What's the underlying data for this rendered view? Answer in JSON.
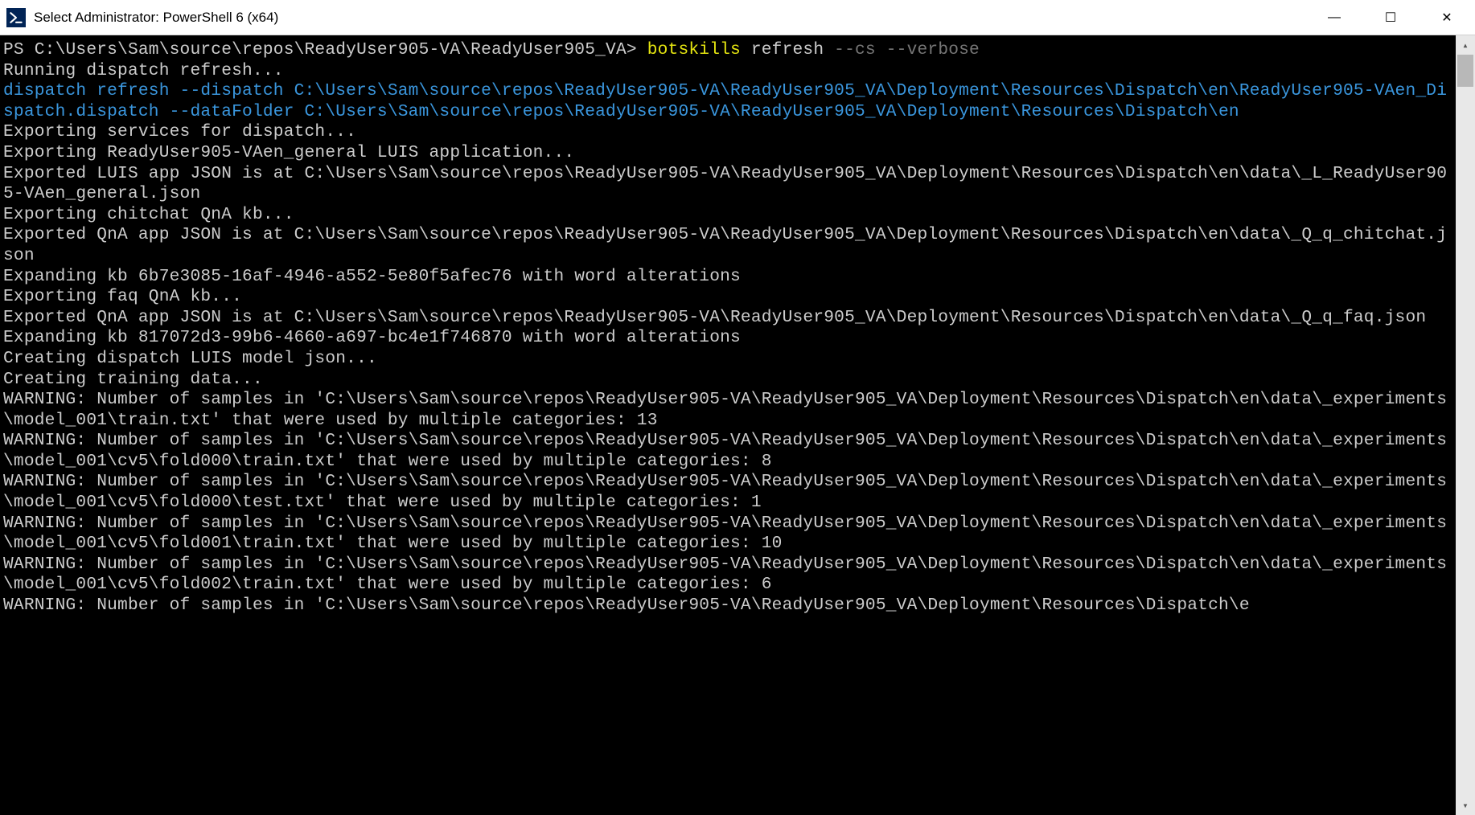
{
  "titlebar": {
    "title": "Select Administrator: PowerShell 6 (x64)"
  },
  "window_controls": {
    "minimize": "—",
    "maximize": "☐",
    "close": "✕"
  },
  "terminal": {
    "prompt_prefix": "PS C:\\Users\\Sam\\source\\repos\\ReadyUser905-VA\\ReadyUser905_VA> ",
    "cmd_bin": "botskills",
    "cmd_sub": " refresh ",
    "cmd_flags": "--cs --verbose",
    "line_running": "Running dispatch refresh...",
    "cyan_cmd": "dispatch refresh --dispatch C:\\Users\\Sam\\source\\repos\\ReadyUser905-VA\\ReadyUser905_VA\\Deployment\\Resources\\Dispatch\\en\\ReadyUser905-VAen_Dispatch.dispatch --dataFolder C:\\Users\\Sam\\source\\repos\\ReadyUser905-VA\\ReadyUser905_VA\\Deployment\\Resources\\Dispatch\\en",
    "line_exp_services": "Exporting services for dispatch...",
    "line_exp_luis": "Exporting ReadyUser905-VAen_general LUIS application...",
    "line_luis_json": "Exported LUIS app JSON is at C:\\Users\\Sam\\source\\repos\\ReadyUser905-VA\\ReadyUser905_VA\\Deployment\\Resources\\Dispatch\\en\\data\\_L_ReadyUser905-VAen_general.json",
    "line_exp_chitchat": "Exporting chitchat QnA kb...",
    "line_qna_chitchat": "Exported QnA app JSON is at C:\\Users\\Sam\\source\\repos\\ReadyUser905-VA\\ReadyUser905_VA\\Deployment\\Resources\\Dispatch\\en\\data\\_Q_q_chitchat.json",
    "line_expand1": "Expanding kb 6b7e3085-16af-4946-a552-5e80f5afec76 with word alterations",
    "line_exp_faq": "Exporting faq QnA kb...",
    "line_qna_faq": "Exported QnA app JSON is at C:\\Users\\Sam\\source\\repos\\ReadyUser905-VA\\ReadyUser905_VA\\Deployment\\Resources\\Dispatch\\en\\data\\_Q_q_faq.json",
    "line_expand2": "Expanding kb 817072d3-99b6-4660-a697-bc4e1f746870 with word alterations",
    "line_creating_model": "Creating dispatch LUIS model json...",
    "line_creating_train": "Creating training data...",
    "warn1": "WARNING: Number of samples in 'C:\\Users\\Sam\\source\\repos\\ReadyUser905-VA\\ReadyUser905_VA\\Deployment\\Resources\\Dispatch\\en\\data\\_experiments\\model_001\\train.txt' that were used by multiple categories: 13",
    "warn2": "WARNING: Number of samples in 'C:\\Users\\Sam\\source\\repos\\ReadyUser905-VA\\ReadyUser905_VA\\Deployment\\Resources\\Dispatch\\en\\data\\_experiments\\model_001\\cv5\\fold000\\train.txt' that were used by multiple categories: 8",
    "warn3": "WARNING: Number of samples in 'C:\\Users\\Sam\\source\\repos\\ReadyUser905-VA\\ReadyUser905_VA\\Deployment\\Resources\\Dispatch\\en\\data\\_experiments\\model_001\\cv5\\fold000\\test.txt' that were used by multiple categories: 1",
    "warn4": "WARNING: Number of samples in 'C:\\Users\\Sam\\source\\repos\\ReadyUser905-VA\\ReadyUser905_VA\\Deployment\\Resources\\Dispatch\\en\\data\\_experiments\\model_001\\cv5\\fold001\\train.txt' that were used by multiple categories: 10",
    "warn5": "WARNING: Number of samples in 'C:\\Users\\Sam\\source\\repos\\ReadyUser905-VA\\ReadyUser905_VA\\Deployment\\Resources\\Dispatch\\en\\data\\_experiments\\model_001\\cv5\\fold002\\train.txt' that were used by multiple categories: 6",
    "warn6": "WARNING: Number of samples in 'C:\\Users\\Sam\\source\\repos\\ReadyUser905-VA\\ReadyUser905_VA\\Deployment\\Resources\\Dispatch\\e"
  },
  "scrollbar": {
    "up_glyph": "▴",
    "down_glyph": "▾"
  }
}
